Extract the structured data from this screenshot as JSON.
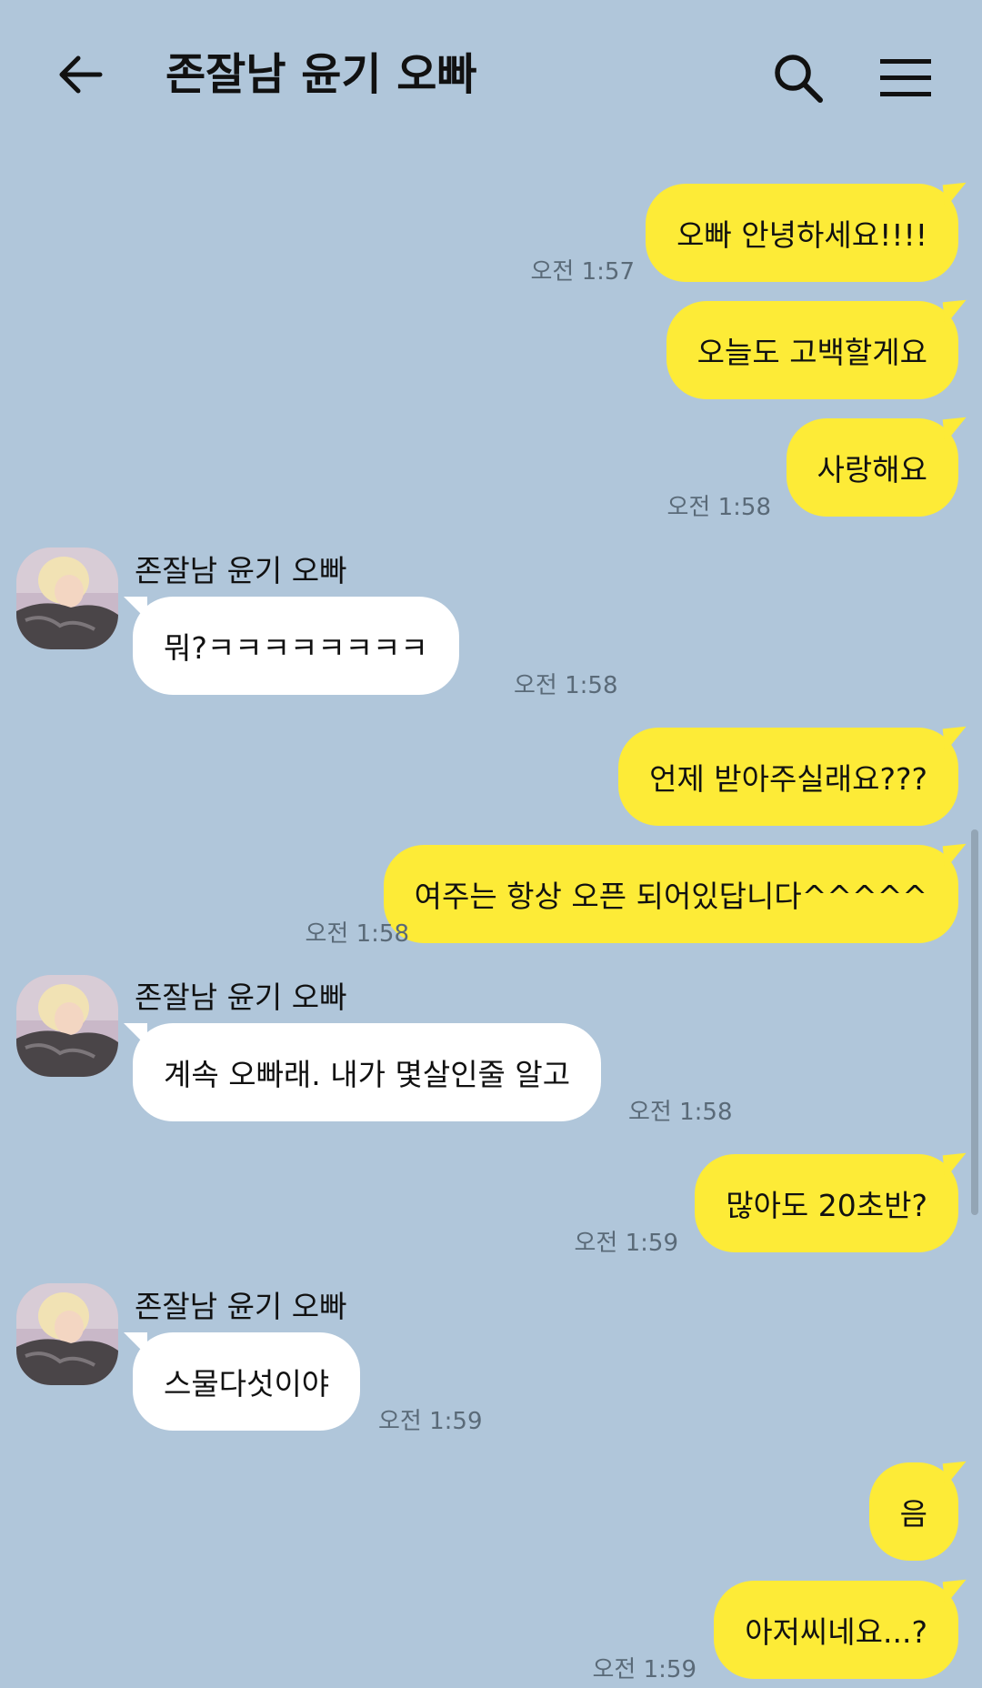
{
  "header": {
    "title": "존잘남 윤기 오빠",
    "back_icon": "arrow-left-icon",
    "search_icon": "search-icon",
    "menu_icon": "hamburger-menu-icon"
  },
  "colors": {
    "background": "#b0c6da",
    "my_bubble": "#fdeb37",
    "their_bubble": "#ffffff",
    "time_text": "#5a6a78"
  },
  "messages": [
    {
      "from": "me",
      "text": "오빠 안녕하세요!!!!",
      "time": "오전 1:57"
    },
    {
      "from": "me",
      "text": "오늘도 고백할게요",
      "time": ""
    },
    {
      "from": "me",
      "text": "사랑해요",
      "time": "오전 1:58"
    },
    {
      "from": "them",
      "sender": "존잘남 윤기 오빠",
      "text": "뭐?ㅋㅋㅋㅋㅋㅋㅋㅋ",
      "time": "오전 1:58"
    },
    {
      "from": "me",
      "text": "언제 받아주실래요???",
      "time": ""
    },
    {
      "from": "me",
      "text": "여주는 항상 오픈 되어있답니다^^^^^",
      "time": "오전 1:58"
    },
    {
      "from": "them",
      "sender": "존잘남 윤기 오빠",
      "text": "계속 오빠래. 내가 몇살인줄 알고",
      "time": "오전 1:58"
    },
    {
      "from": "me",
      "text": "많아도 20초반?",
      "time": "오전 1:59"
    },
    {
      "from": "them",
      "sender": "존잘남 윤기 오빠",
      "text": "스물다섯이야",
      "time": "오전 1:59"
    },
    {
      "from": "me",
      "text": "음",
      "time": ""
    },
    {
      "from": "me",
      "text": "아저씨네요...?",
      "time": "오전 1:59"
    }
  ]
}
